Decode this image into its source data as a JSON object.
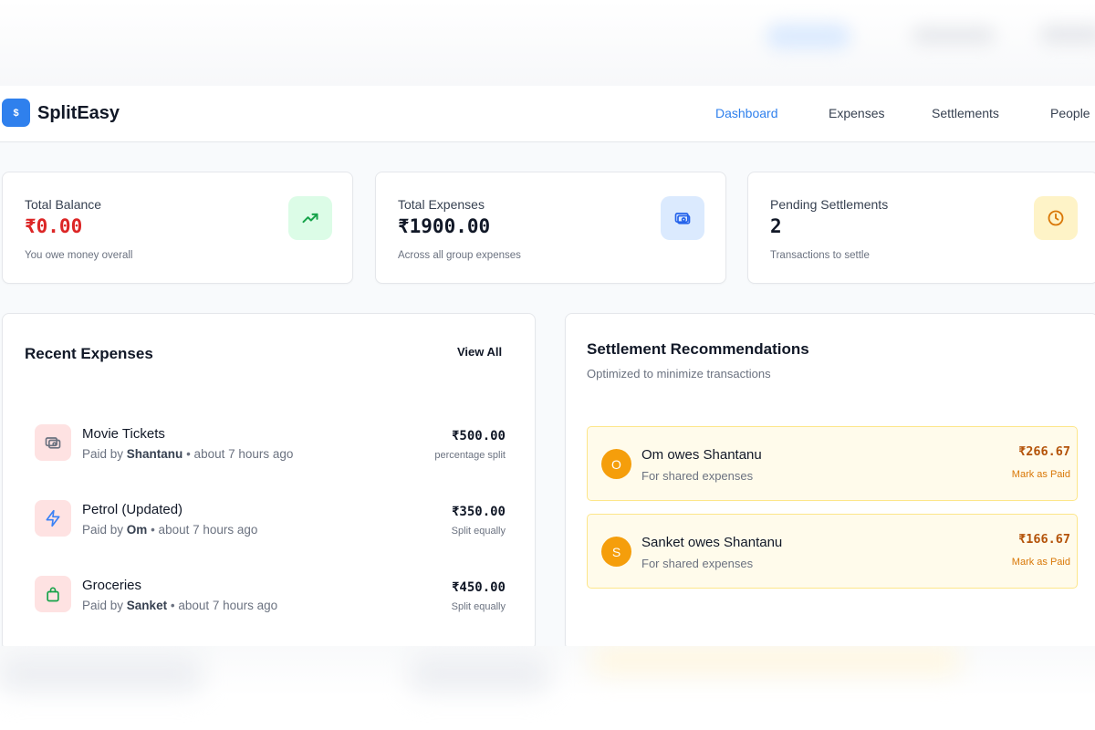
{
  "brand": {
    "name": "SplitEasy",
    "logo_glyph": "$",
    "accent": "#2f80ed"
  },
  "nav": {
    "active": "Dashboard",
    "items": [
      "Dashboard",
      "Expenses",
      "Settlements",
      "People"
    ]
  },
  "stats": [
    {
      "label": "Total Balance",
      "value": "₹0.00",
      "sub": "You owe money overall",
      "icon": "trending-up-icon",
      "value_color": "#dc2626"
    },
    {
      "label": "Total Expenses",
      "value": "₹1900.00",
      "sub": "Across all group expenses",
      "icon": "banknote-icon"
    },
    {
      "label": "Pending Settlements",
      "value": "2",
      "sub": "Transactions to settle",
      "icon": "clock-icon"
    }
  ],
  "recent": {
    "title": "Recent Expenses",
    "view_all": "View All",
    "items": [
      {
        "title": "Movie Tickets",
        "paid_prefix": "Paid by",
        "payer": "Shantanu",
        "time": "• about 7 hours ago",
        "amount": "₹500.00",
        "split": "percentage split",
        "icon": "ticket-icon"
      },
      {
        "title": "Petrol (Updated)",
        "paid_prefix": "Paid by",
        "payer": "Om",
        "time": "• about 7 hours ago",
        "amount": "₹350.00",
        "split": "Split equally",
        "icon": "lightning-icon"
      },
      {
        "title": "Groceries",
        "paid_prefix": "Paid by",
        "payer": "Sanket",
        "time": "• about 7 hours ago",
        "amount": "₹450.00",
        "split": "Split equally",
        "icon": "shopping-bag-icon"
      }
    ]
  },
  "settlements": {
    "title": "Settlement Recommendations",
    "subtitle": "Optimized to minimize transactions",
    "items": [
      {
        "initial": "O",
        "title": "Om owes Shantanu",
        "desc": "For shared expenses",
        "amount": "₹266.67",
        "action": "Mark as Paid"
      },
      {
        "initial": "S",
        "title": "Sanket owes Shantanu",
        "desc": "For shared expenses",
        "amount": "₹166.67",
        "action": "Mark as Paid"
      }
    ]
  }
}
